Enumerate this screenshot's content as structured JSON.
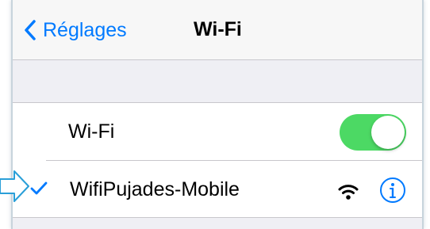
{
  "navbar": {
    "back_label": "Réglages",
    "title": "Wi-Fi"
  },
  "wifi_toggle": {
    "label": "Wi-Fi",
    "state": "on"
  },
  "network": {
    "name": "WifiPujades-Mobile",
    "connected": true,
    "signal": "full"
  },
  "icons": {
    "back": "chevron-left-icon",
    "check": "checkmark-icon",
    "signal": "wifi-signal-icon",
    "info": "info-icon",
    "pointer": "pointer-arrow-icon"
  },
  "colors": {
    "accent": "#007aff",
    "toggle_on": "#4cd964",
    "background": "#efeff4",
    "annotation": "#2a9fd8"
  }
}
